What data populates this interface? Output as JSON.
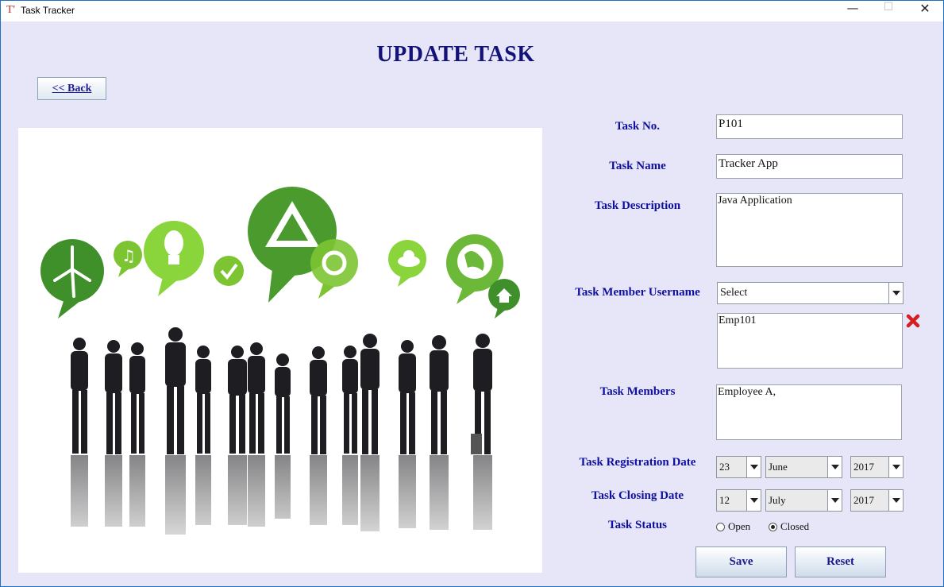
{
  "window": {
    "title": "Task Tracker",
    "icon": "T'"
  },
  "heading": "UPDATE TASK",
  "back_button": "<< Back",
  "form": {
    "task_no_label": "Task No.",
    "task_no_value": "P101",
    "task_name_label": "Task Name",
    "task_name_value": "Tracker App",
    "task_description_label": "Task Description",
    "task_description_value": "Java Application",
    "member_username_label": "Task Member Username",
    "member_username_select": "Select",
    "selected_members_value": "Emp101",
    "task_members_label": "Task Members",
    "task_members_value": "Employee A,",
    "registration_date_label": "Task Registration Date",
    "registration_date": {
      "day": "23",
      "month": "June",
      "year": "2017"
    },
    "closing_date_label": "Task Closing Date",
    "closing_date": {
      "day": "12",
      "month": "July",
      "year": "2017"
    },
    "status_label": "Task Status",
    "status_options": [
      "Open",
      "Closed"
    ],
    "status_selected": "Closed"
  },
  "buttons": {
    "save": "Save",
    "reset": "Reset"
  },
  "colors": {
    "background": "#e6e6f8",
    "label": "#1010a0",
    "heading": "#12127a",
    "remove": "#d42020"
  },
  "icons": [
    "app-icon",
    "minimize-icon",
    "maximize-icon",
    "close-icon",
    "remove-member-icon",
    "dropdown-arrow-icon"
  ]
}
